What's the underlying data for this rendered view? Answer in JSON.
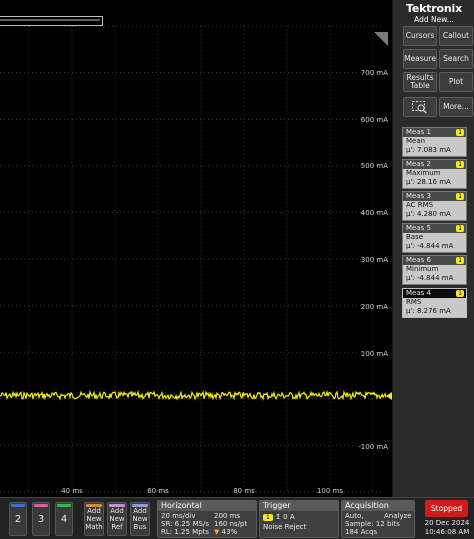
{
  "brand": "Tektronix",
  "add_new": "Add New...",
  "panel_buttons": [
    {
      "label": "Cursors"
    },
    {
      "label": "Callout"
    },
    {
      "label": "Measure"
    },
    {
      "label": "Search"
    },
    {
      "label": "Results Table"
    },
    {
      "label": "Plot"
    },
    {
      "label": ""
    },
    {
      "label": "More..."
    }
  ],
  "measurements": [
    {
      "title": "Meas 1",
      "badge": "1",
      "name": "Mean",
      "value": "μ': 7.083 mA"
    },
    {
      "title": "Meas 2",
      "badge": "1",
      "name": "Maximum",
      "value": "μ': 28.16 mA"
    },
    {
      "title": "Meas 3",
      "badge": "1",
      "name": "AC RMS",
      "value": "μ': 4.280 mA"
    },
    {
      "title": "Meas 5",
      "badge": "1",
      "name": "Base",
      "value": "μ': -4.844 mA"
    },
    {
      "title": "Meas 6",
      "badge": "1",
      "name": "Minimum",
      "value": "μ': -4.844 mA"
    },
    {
      "title": "Meas 4",
      "badge": "1",
      "name": "RMS",
      "value": "μ': 8.276 mA"
    }
  ],
  "plot": {
    "y_labels": [
      "700 mA",
      "600 mA",
      "500 mA",
      "400 mA",
      "300 mA",
      "200 mA",
      "100 mA",
      "-100 mA"
    ],
    "x_labels": [
      "40 ms",
      "60 ms",
      "80 ms",
      "100 ms"
    ],
    "trace_color": "#f5e81c",
    "trace_level_mA": 7.083
  },
  "channels": [
    "2",
    "3",
    "4"
  ],
  "channel_colors": [
    "#3b6fd8",
    "#e05b9a",
    "#2fbf4a"
  ],
  "add_buttons": [
    {
      "label": "Add New Math",
      "color": "#d98a2b"
    },
    {
      "label": "Add New Ref",
      "color": "#c98ad6"
    },
    {
      "label": "Add New Bus",
      "color": "#8a9bd6"
    }
  ],
  "horizontal": {
    "title": "Horizontal",
    "scale": "20 ms/div",
    "duration": "200 ms",
    "sample_rate": "SR: 6.25 MS/s",
    "pt_rate": "160 ns/pt",
    "record_length": "RL: 1.25 Mpts",
    "position": "43%"
  },
  "trigger": {
    "title": "Trigger",
    "source": "1",
    "level": "0 A",
    "mode": "Noise Reject"
  },
  "acquisition": {
    "title": "Acquisition",
    "mode": "Auto,",
    "analyze": "Analyze",
    "sample": "Sample: 12 bits",
    "acqs": "184 Acqs"
  },
  "status": "Stopped",
  "date": "20 Dec 2024",
  "time": "10:46:08 AM"
}
